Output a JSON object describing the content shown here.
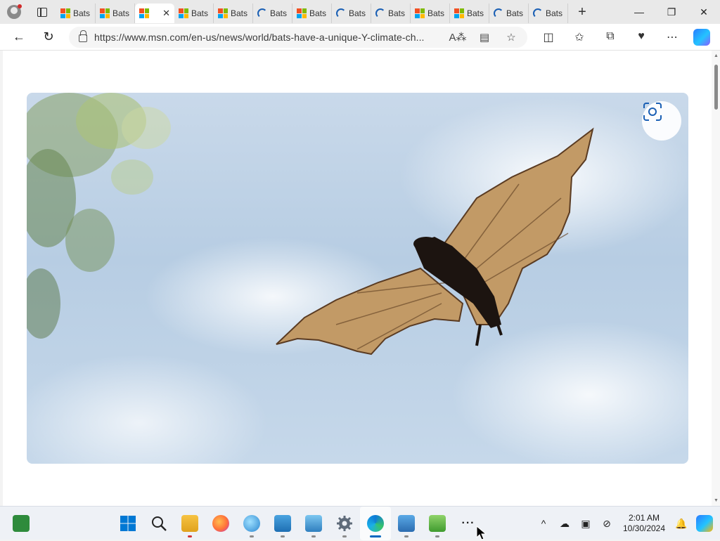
{
  "browser": {
    "tabs": [
      {
        "label": "Bats",
        "favicon": "microsoft-logo",
        "active": false
      },
      {
        "label": "Bats",
        "favicon": "microsoft-logo",
        "active": false
      },
      {
        "label": "",
        "favicon": "microsoft-logo",
        "active": true
      },
      {
        "label": "Bats",
        "favicon": "microsoft-logo",
        "active": false
      },
      {
        "label": "Bats",
        "favicon": "microsoft-logo",
        "active": false
      },
      {
        "label": "Bats",
        "favicon": "loading-spinner",
        "active": false
      },
      {
        "label": "Bats",
        "favicon": "microsoft-logo",
        "active": false
      },
      {
        "label": "Bats",
        "favicon": "loading-spinner",
        "active": false
      },
      {
        "label": "Bats",
        "favicon": "loading-spinner",
        "active": false
      },
      {
        "label": "Bats",
        "favicon": "microsoft-logo",
        "active": false
      },
      {
        "label": "Bats",
        "favicon": "microsoft-logo",
        "active": false
      },
      {
        "label": "Bats",
        "favicon": "loading-spinner",
        "active": false
      },
      {
        "label": "Bats",
        "favicon": "loading-spinner",
        "active": false
      }
    ],
    "close_tab_glyph": "✕",
    "new_tab_glyph": "+",
    "window_controls": {
      "minimize": "—",
      "restore": "❐",
      "close": "✕"
    },
    "address": {
      "url": "https://www.msn.com/en-us/news/world/bats-have-a-unique-Y-climate-ch..."
    },
    "nav": {
      "back": "←",
      "refresh": "↻"
    }
  },
  "page": {
    "hero_image": "bat-in-flight-photo",
    "visual_search": "visual-search-icon"
  },
  "taskbar": {
    "apps": [
      "file-explorer",
      "firefox",
      "globe-app",
      "photos-app",
      "remote-desktop",
      "settings",
      "edge",
      "notepad",
      "app-green",
      "more"
    ],
    "clock": {
      "time": "2:01 AM",
      "date": "10/30/2024"
    },
    "more_glyph": "···",
    "tray_chevron": "^"
  },
  "colors": {
    "accent": "#0067c0",
    "sky": "#b7cde3",
    "bat_wing": "#c29a66",
    "bat_body": "#1c1410"
  }
}
